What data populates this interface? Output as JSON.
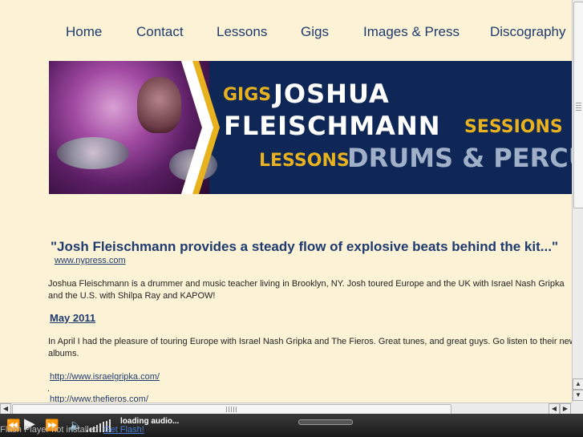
{
  "nav": {
    "items": [
      "Home",
      "Contact",
      "Lessons",
      "Gigs",
      "Images & Press",
      "Discography"
    ]
  },
  "banner": {
    "gigs": "GIGS",
    "name_line1": "JOSHUA",
    "name_line2": "FLEISCHMANN",
    "sessions": "SESSIONS",
    "lessons": "LESSONS",
    "tagline": "DRUMS & PERCUSSION",
    "colors": {
      "background": "#0f2756",
      "accent": "#e8b21e",
      "muted": "#9fb0c8"
    }
  },
  "quote": {
    "text": "\"Josh Fleischmann provides a steady flow of explosive beats behind the kit...\"",
    "source": "www.nypress.com"
  },
  "bio": {
    "line1": "Joshua Fleischmann is a drummer and music teacher living in Brooklyn, NY.  Josh toured Europe and the UK with  Israel Nash  Gripka",
    "line2": "and the U.S. with Shilpa Ray and KAPOW!"
  },
  "news": {
    "heading": "May 2011",
    "line1": "In April I had the pleasure of touring Europe with Israel Nash Gripka and The Fieros.  Great tunes, and great guys.  Go listen to their  new",
    "line2": "albums.",
    "link1": "http://www.israelgripka.com/",
    "separator": ".",
    "link2": "http://www.thefieros.com/"
  },
  "player": {
    "status": "loading audio...",
    "icons": [
      "rewind-icon",
      "play-icon",
      "fast-forward-icon",
      "volume-icon"
    ]
  },
  "overlay": {
    "text_prefix": "Flash Player not installed: ",
    "link": "Get Flash!"
  },
  "scrollbars": {
    "vertical_position": 0,
    "horizontal_position": 0
  }
}
